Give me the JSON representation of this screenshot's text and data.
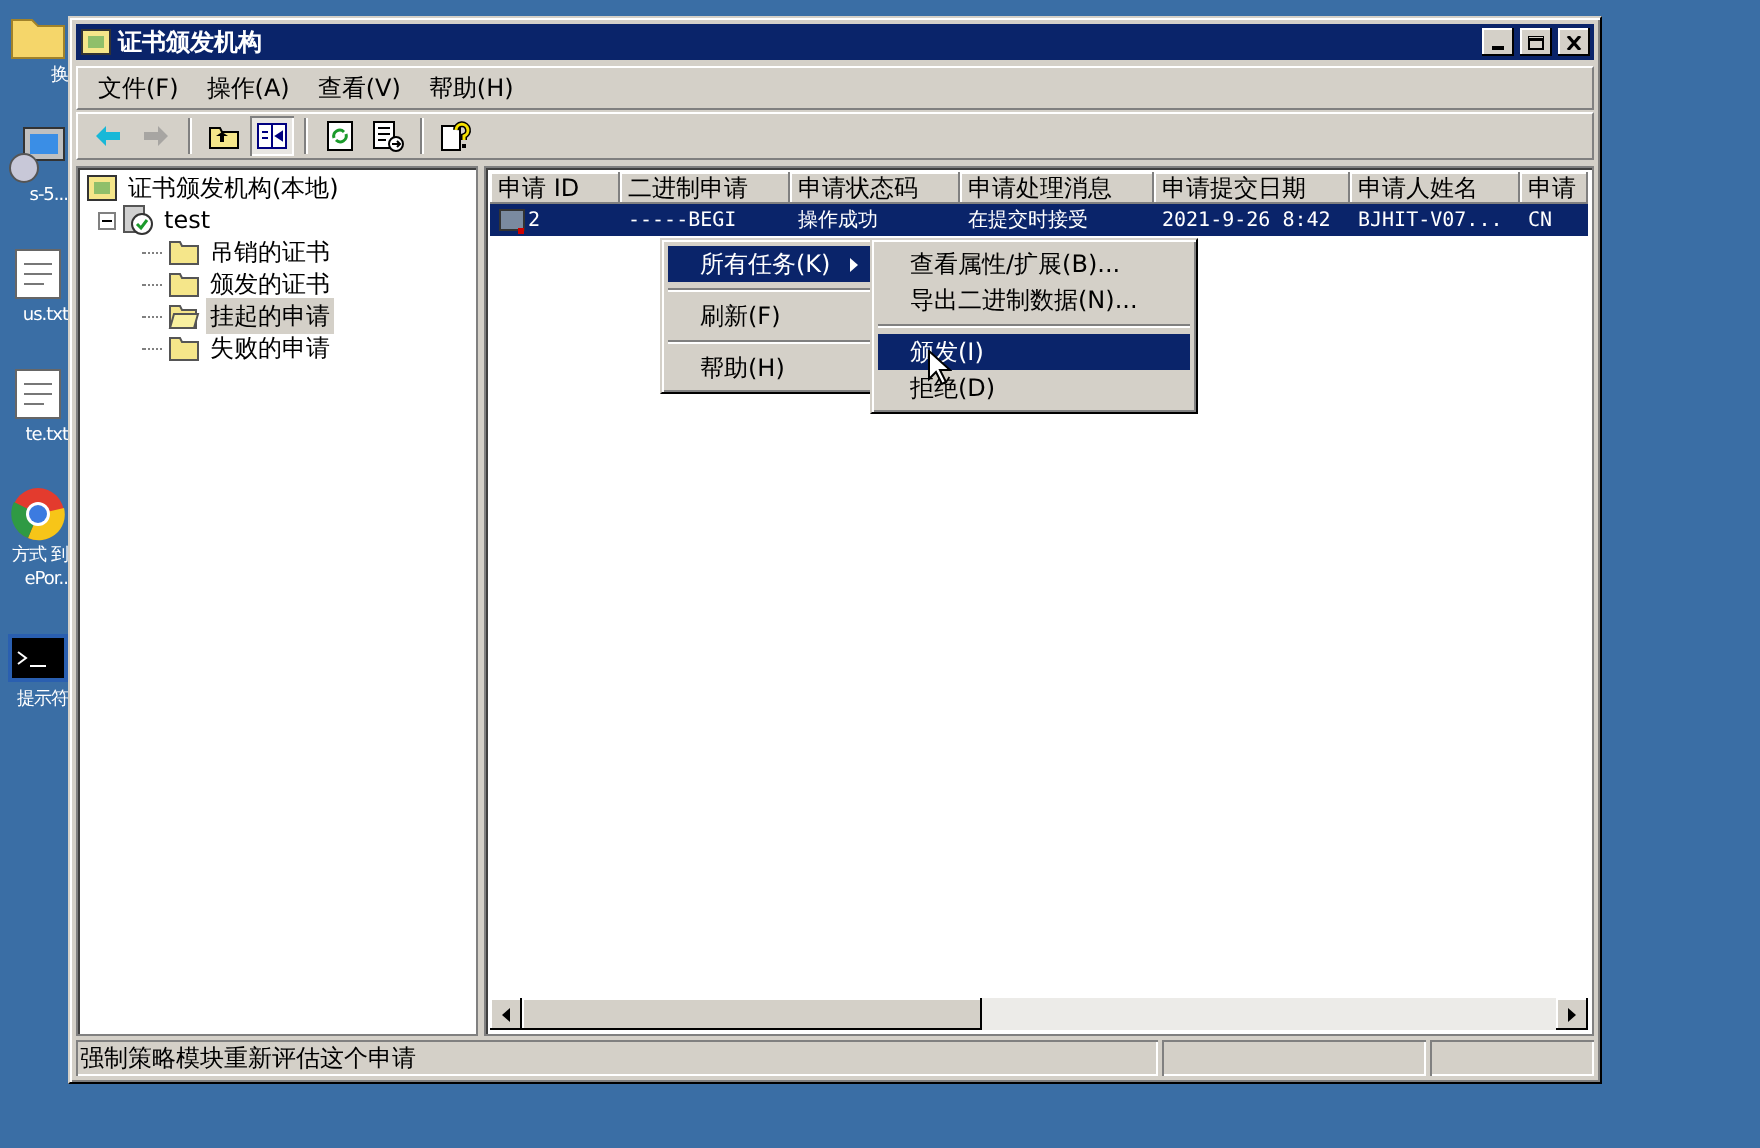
{
  "desktop": {
    "icons": [
      {
        "kind": "folder",
        "lines": [
          "换"
        ]
      },
      {
        "kind": "computer",
        "lines": [
          "s-5..."
        ]
      },
      {
        "kind": "notepad",
        "lines": [
          "us.txt"
        ]
      },
      {
        "kind": "notepad",
        "lines": [
          "te.txt"
        ]
      },
      {
        "kind": "browser",
        "lines": [
          "方式 到",
          "ePor.."
        ]
      },
      {
        "kind": "terminal",
        "lines": [
          "提示符"
        ]
      }
    ]
  },
  "window": {
    "title": "证书颁发机构",
    "menu": [
      "文件(F)",
      "操作(A)",
      "查看(V)",
      "帮助(H)"
    ],
    "toolbar": [
      {
        "kind": "back",
        "disabled": false,
        "pressed": false
      },
      {
        "kind": "forward",
        "disabled": true,
        "pressed": false
      },
      {
        "kind": "sep"
      },
      {
        "kind": "up",
        "disabled": false,
        "pressed": false
      },
      {
        "kind": "tree",
        "disabled": false,
        "pressed": true
      },
      {
        "kind": "sep"
      },
      {
        "kind": "refresh",
        "disabled": false,
        "pressed": false
      },
      {
        "kind": "export",
        "disabled": false,
        "pressed": false
      },
      {
        "kind": "sep"
      },
      {
        "kind": "help",
        "disabled": false,
        "pressed": false
      }
    ],
    "tree": {
      "label": "证书颁发机构(本地)",
      "kind": "root",
      "selected": false,
      "children": [
        {
          "label": "test",
          "kind": "ca",
          "expanded": true,
          "selected": false,
          "children": [
            {
              "label": "吊销的证书",
              "kind": "folder",
              "selected": false
            },
            {
              "label": "颁发的证书",
              "kind": "folder",
              "selected": false
            },
            {
              "label": "挂起的申请",
              "kind": "folder",
              "selected": true
            },
            {
              "label": "失败的申请",
              "kind": "folder",
              "selected": false
            }
          ]
        }
      ]
    },
    "table": {
      "columns": [
        "申请 ID",
        "二进制申请",
        "申请状态码",
        "申请处理消息",
        "申请提交日期",
        "申请人姓名",
        "申请"
      ],
      "rows": [
        {
          "selected": true,
          "cells": [
            "2",
            "-----BEGI",
            "操作成功",
            "在提交时接受",
            "2021-9-26 8:42",
            "BJHIT-V07...",
            "CN"
          ]
        }
      ]
    }
  },
  "context_menu": {
    "items": [
      {
        "kind": "item",
        "label": "所有任务(K)",
        "submenu": true,
        "selected": true
      },
      {
        "kind": "separator"
      },
      {
        "kind": "item",
        "label": "刷新(F)",
        "submenu": false,
        "selected": false
      },
      {
        "kind": "separator"
      },
      {
        "kind": "item",
        "label": "帮助(H)",
        "submenu": false,
        "selected": false
      }
    ]
  },
  "submenu": {
    "items": [
      {
        "kind": "item",
        "label": "查看属性/扩展(B)...",
        "selected": false
      },
      {
        "kind": "item",
        "label": "导出二进制数据(N)...",
        "selected": false
      },
      {
        "kind": "separator"
      },
      {
        "kind": "item",
        "label": "颁发(I)",
        "selected": true
      },
      {
        "kind": "item",
        "label": "拒绝(D)",
        "selected": false
      }
    ]
  },
  "status_bar": {
    "text": "强制策略模块重新评估这个申请"
  }
}
